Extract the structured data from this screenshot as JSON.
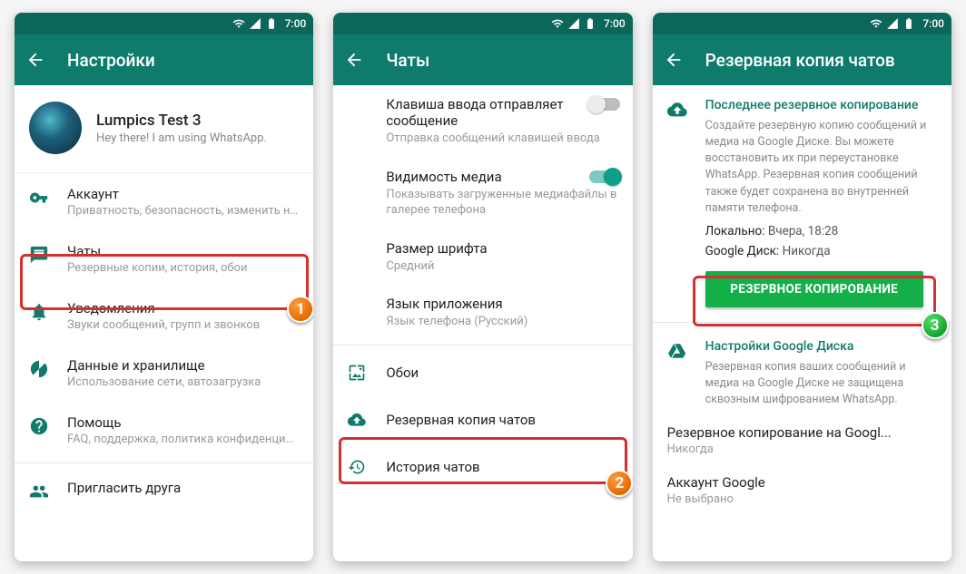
{
  "status": {
    "time": "7:00"
  },
  "screen1": {
    "title": "Настройки",
    "profile": {
      "name": "Lumpics Test 3",
      "status": "Hey there! I am using WhatsApp."
    },
    "items": [
      {
        "label": "Аккаунт",
        "sub": "Приватность, безопасность, изменить но..."
      },
      {
        "label": "Чаты",
        "sub": "Резервные копии, история, обои"
      },
      {
        "label": "Уведомления",
        "sub": "Звуки сообщений, групп и звонков"
      },
      {
        "label": "Данные и хранилище",
        "sub": "Использование сети, автозагрузка"
      },
      {
        "label": "Помощь",
        "sub": "FAQ, поддержка, политика конфиденциал..."
      },
      {
        "label": "Пригласить друга",
        "sub": ""
      }
    ],
    "badge": "1"
  },
  "screen2": {
    "title": "Чаты",
    "settings": [
      {
        "label": "Клавиша ввода отправляет сообщение",
        "sub": "Отправка сообщений клавишей ввода",
        "toggle": false
      },
      {
        "label": "Видимость медиа",
        "sub": "Показывать загруженные медиафайлы в галерее телефона",
        "toggle": true
      },
      {
        "label": "Размер шрифта",
        "sub": "Средний"
      },
      {
        "label": "Язык приложения",
        "sub": "Язык телефона (Русский)"
      }
    ],
    "menu": [
      {
        "label": "Обои"
      },
      {
        "label": "Резервная копия чатов"
      },
      {
        "label": "История чатов"
      }
    ],
    "badge": "2"
  },
  "screen3": {
    "title": "Резервная копия чатов",
    "section1": {
      "head": "Последнее резервное копирование",
      "desc": "Создайте резервную копию сообщений и медиа на Google Диске. Вы можете восстановить их при переустановке WhatsApp. Резервная копия сообщений также будет сохранена во внутренней памяти телефона.",
      "local_k": "Локально:",
      "local_v": "Вчера, 18:28",
      "gdrive_k": "Google Диск:",
      "gdrive_v": "Никогда",
      "button": "РЕЗЕРВНОЕ КОПИРОВАНИЕ"
    },
    "section2": {
      "head": "Настройки Google Диска",
      "desc": "Резервная копия ваших сообщений и медиа на Google Диске не защищена сквозным шифрованием WhatsApp."
    },
    "rows": [
      {
        "label": "Резервное копирование на Googl...",
        "sub": "Никогда"
      },
      {
        "label": "Аккаунт Google",
        "sub": "Не выбрано"
      }
    ],
    "badge": "3"
  }
}
